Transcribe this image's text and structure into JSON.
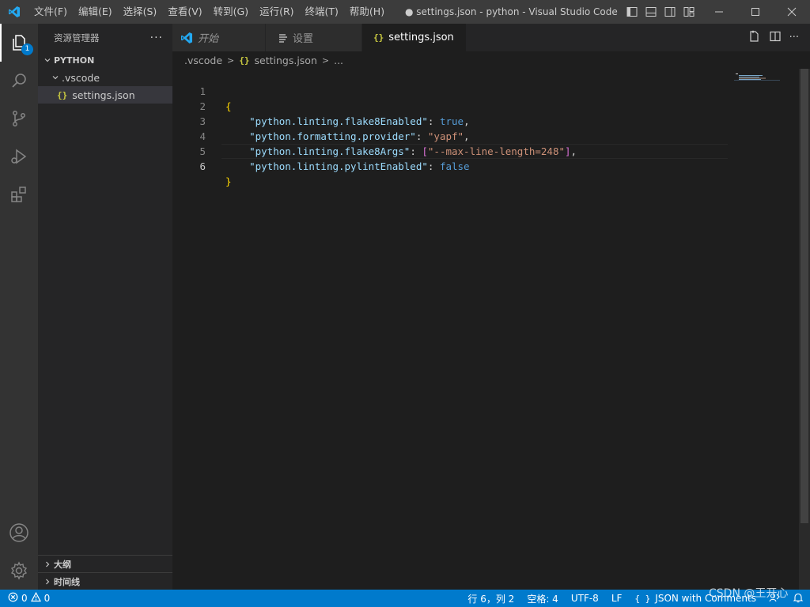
{
  "titlebar": {
    "menu": [
      "文件(F)",
      "编辑(E)",
      "选择(S)",
      "查看(V)",
      "转到(G)",
      "运行(R)",
      "终端(T)",
      "帮助(H)"
    ],
    "window_title": "● settings.json - python - Visual Studio Code [管..."
  },
  "activitybar": {
    "explorer_badge": "1"
  },
  "sidebar": {
    "title": "资源管理器",
    "more": "···",
    "folder_name": "PYTHON",
    "subfolder": ".vscode",
    "file": "settings.json",
    "outline": "大纲",
    "timeline": "时间线"
  },
  "tabs": [
    {
      "label": "开始"
    },
    {
      "label": "设置"
    },
    {
      "label": "settings.json"
    }
  ],
  "breadcrumb": {
    "folder": ".vscode",
    "file": "settings.json",
    "more": "..."
  },
  "editor": {
    "lines": [
      {
        "num": "1"
      },
      {
        "num": "2",
        "key": "\"python.linting.flake8Enabled\"",
        "value": "true"
      },
      {
        "num": "3",
        "key": "\"python.formatting.provider\"",
        "value": "\"yapf\""
      },
      {
        "num": "4",
        "key": "\"python.linting.flake8Args\"",
        "value": "\"--max-line-length=248\""
      },
      {
        "num": "5",
        "key": "\"python.linting.pylintEnabled\"",
        "value": "false"
      },
      {
        "num": "6"
      }
    ],
    "open_brace": "{",
    "close_brace": "}"
  },
  "statusbar": {
    "errors": "0",
    "warnings": "0",
    "cursor": "行 6，列 2",
    "spaces": "空格: 4",
    "encoding": "UTF-8",
    "eol": "LF",
    "language": "JSON with Comments"
  },
  "watermark": "CSDN @王开心"
}
